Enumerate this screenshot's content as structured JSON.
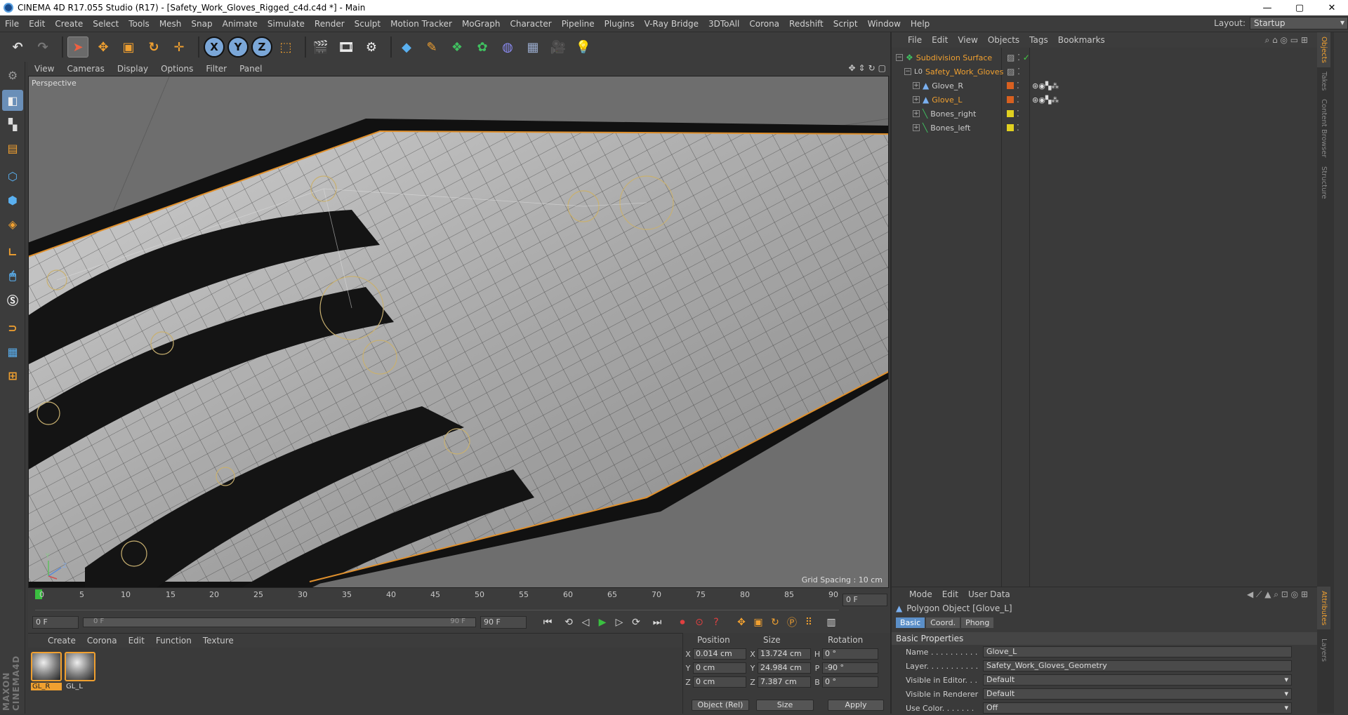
{
  "window": {
    "title": "CINEMA 4D R17.055 Studio (R17) - [Safety_Work_Gloves_Rigged_c4d.c4d *] - Main",
    "controls": [
      "—",
      "▢",
      "✕"
    ]
  },
  "menubar": {
    "items": [
      "File",
      "Edit",
      "Create",
      "Select",
      "Tools",
      "Mesh",
      "Snap",
      "Animate",
      "Simulate",
      "Render",
      "Sculpt",
      "Motion Tracker",
      "MoGraph",
      "Character",
      "Pipeline",
      "Plugins",
      "V-Ray Bridge",
      "3DToAll",
      "Corona",
      "Redshift",
      "Script",
      "Window",
      "Help"
    ],
    "layout_label": "Layout:",
    "layout_value": "Startup"
  },
  "viewport": {
    "menu": [
      "View",
      "Cameras",
      "Display",
      "Options",
      "Filter",
      "Panel"
    ],
    "label": "Perspective",
    "grid_spacing": "Grid Spacing : 10 cm"
  },
  "timeline": {
    "ticks": [
      "0",
      "5",
      "10",
      "15",
      "20",
      "25",
      "30",
      "35",
      "40",
      "45",
      "50",
      "55",
      "60",
      "65",
      "70",
      "75",
      "80",
      "85",
      "90"
    ],
    "current_frame": "0 F",
    "start": "0 F",
    "range_start": "0 F",
    "range_end": "90 F",
    "end": "90 F"
  },
  "materials": {
    "menu": [
      "Create",
      "Corona",
      "Edit",
      "Function",
      "Texture"
    ],
    "items": [
      {
        "label": "GL_R"
      },
      {
        "label": "GL_L"
      }
    ]
  },
  "coords": {
    "headers": [
      "Position",
      "Size",
      "Rotation"
    ],
    "rows": [
      {
        "axis": "X",
        "pos": "0.014 cm",
        "size_axis": "X",
        "size": "13.724 cm",
        "rot_axis": "H",
        "rot": "0 °"
      },
      {
        "axis": "Y",
        "pos": "0 cm",
        "size_axis": "Y",
        "size": "24.984 cm",
        "rot_axis": "P",
        "rot": "-90 °"
      },
      {
        "axis": "Z",
        "pos": "0 cm",
        "size_axis": "Z",
        "size": "7.387 cm",
        "rot_axis": "B",
        "rot": "0 °"
      }
    ],
    "mode": "Object (Rel)",
    "size_mode": "Size",
    "apply": "Apply"
  },
  "objects": {
    "menu": [
      "File",
      "Edit",
      "View",
      "Objects",
      "Tags",
      "Bookmarks"
    ],
    "tree": [
      {
        "name": "Subdivision Surface",
        "indent": 0,
        "highlight": true
      },
      {
        "name": "Safety_Work_Gloves",
        "indent": 1,
        "highlight": true
      },
      {
        "name": "Glove_R",
        "indent": 2,
        "highlight": false
      },
      {
        "name": "Glove_L",
        "indent": 2,
        "highlight": true
      },
      {
        "name": "Bones_right",
        "indent": 2,
        "highlight": false
      },
      {
        "name": "Bones_left",
        "indent": 2,
        "highlight": false
      }
    ]
  },
  "sidetabs": [
    "Objects",
    "Takes",
    "Content Browser",
    "Structure"
  ],
  "sidetabs_bottom": [
    "Attributes",
    "Layers"
  ],
  "attributes": {
    "menu": [
      "Mode",
      "Edit",
      "User Data"
    ],
    "title": "Polygon Object [Glove_L]",
    "tabs": [
      "Basic",
      "Coord.",
      "Phong"
    ],
    "section": "Basic Properties",
    "fields": [
      {
        "label": "Name . . . . . . . . . .",
        "value": "Glove_L"
      },
      {
        "label": "Layer. . . . . . . . . . .",
        "value": "Safety_Work_Gloves_Geometry"
      },
      {
        "label": "Visible in Editor. . .",
        "value": "Default"
      },
      {
        "label": "Visible in Renderer",
        "value": "Default"
      },
      {
        "label": "Use Color. . . . . . .",
        "value": "Off"
      }
    ]
  }
}
